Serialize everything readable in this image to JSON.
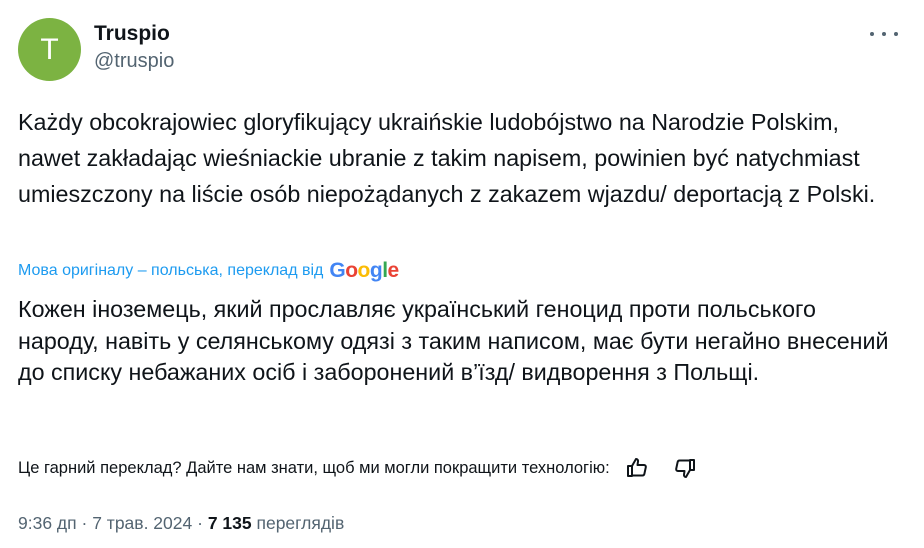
{
  "author": {
    "avatar_letter": "T",
    "avatar_color": "#7cb342",
    "display_name": "Truspio",
    "handle": "@truspio"
  },
  "icons": {
    "more": "more-horizontal-icon",
    "like": "thumbs-up-icon",
    "dislike": "thumbs-down-icon"
  },
  "tweet": {
    "original_text": "Każdy obcokrajowiec gloryfikujący ukraińskie ludobójstwo na Narodzie Polskim, nawet zakładając wieśniackie ubranie z takim napisem, powinien być natychmiast umieszczony na liście osób niepożądanych z zakazem wjazdu/ deportacją z Polski.",
    "translation_note": "Мова оригіналу – польська, переклад від",
    "translation_provider": [
      "G",
      "o",
      "o",
      "g",
      "l",
      "e"
    ],
    "translated_text": "Кожен іноземець, який прославляє український геноцид проти польського народу, навіть у селянському одязі з таким написом, має бути негайно внесений до списку небажаних осіб і заборонений в’їзд/ видворення з Польщі.",
    "feedback_prompt": "Це гарний переклад? Дайте нам знати, щоб ми могли покращити технологію:"
  },
  "meta": {
    "time": "9:36 дп",
    "separator": "·",
    "date": "7 трав. 2024",
    "views_count": "7 135",
    "views_label": "переглядів"
  },
  "colors": {
    "accent": "#1d9bf0",
    "secondary_text": "#536471",
    "primary_text": "#0f1419"
  }
}
